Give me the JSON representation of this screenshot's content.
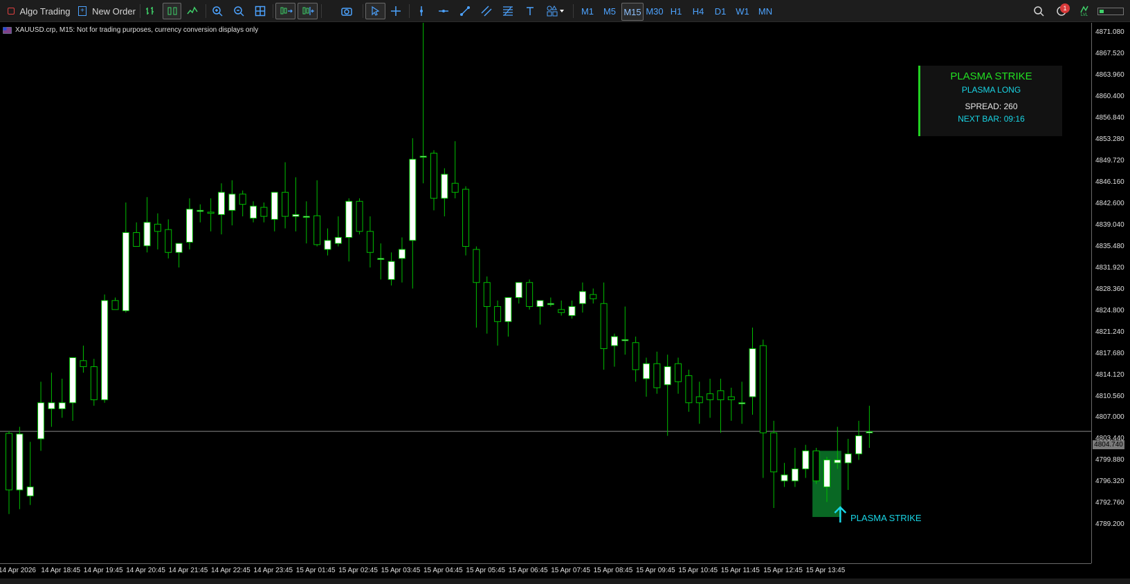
{
  "toolbar": {
    "algo_trading": "Algo Trading",
    "new_order": "New Order",
    "timeframes": [
      "M1",
      "M5",
      "M15",
      "M30",
      "H1",
      "H4",
      "D1",
      "W1",
      "MN"
    ],
    "selected_timeframe": "M15",
    "notification_count": "1",
    "lvl_label": "LVL"
  },
  "symbol_info": "XAUUSD.crp, M15:  Not for trading purposes, currency conversion displays only",
  "panel": {
    "title": "PLASMA STRIKE",
    "signal": "PLASMA LONG",
    "spread": "SPREAD: 260",
    "next_bar": "NEXT BAR: 09:16"
  },
  "signal_label": "PLASMA STRIKE",
  "current_price": "4804.740",
  "colors": {
    "bull_fill": "#ffffff",
    "bear_fill": "#000000",
    "candle_border": "#00c000",
    "wick": "#00c000",
    "signal_box": "#0a7a2a",
    "signal_arrow": "#19d6e6",
    "panel_accent": "#22d022"
  },
  "chart_data": {
    "type": "candlestick",
    "symbol": "XAUUSD.crp",
    "timeframe": "M15",
    "price_ticks": [
      "4871.080",
      "4867.520",
      "4863.960",
      "4860.400",
      "4856.840",
      "4853.280",
      "4849.720",
      "4846.160",
      "4842.600",
      "4839.040",
      "4835.480",
      "4831.920",
      "4828.360",
      "4824.800",
      "4821.240",
      "4817.680",
      "4814.120",
      "4810.560",
      "4807.000",
      "4803.440",
      "4799.880",
      "4796.320",
      "4792.760",
      "4789.200"
    ],
    "time_labels": [
      "14 Apr 2026",
      "14 Apr 18:45",
      "14 Apr 19:45",
      "14 Apr 20:45",
      "14 Apr 21:45",
      "14 Apr 22:45",
      "14 Apr 23:45",
      "15 Apr 01:45",
      "15 Apr 02:45",
      "15 Apr 03:45",
      "15 Apr 04:45",
      "15 Apr 05:45",
      "15 Apr 06:45",
      "15 Apr 07:45",
      "15 Apr 08:45",
      "15 Apr 09:45",
      "15 Apr 10:45",
      "15 Apr 11:45",
      "15 Apr 12:45",
      "15 Apr 13:45"
    ],
    "ylim": [
      4786.5,
      4874.0
    ],
    "candles": [
      [
        4804.4,
        4804.8,
        4791.0,
        4795.0
      ],
      [
        4795.0,
        4805.5,
        4791.8,
        4804.3
      ],
      [
        4794.0,
        4803.0,
        4792.5,
        4795.5
      ],
      [
        4803.5,
        4813.0,
        4801.5,
        4809.5
      ],
      [
        4808.5,
        4814.5,
        4805.5,
        4809.5
      ],
      [
        4808.5,
        4813.5,
        4807.0,
        4809.5
      ],
      [
        4809.5,
        4816.5,
        4806.5,
        4817.0
      ],
      [
        4816.5,
        4819.0,
        4814.5,
        4815.5
      ],
      [
        4815.5,
        4816.8,
        4809.0,
        4810.0
      ],
      [
        4810.0,
        4827.5,
        4809.5,
        4826.5
      ],
      [
        4826.5,
        4827.0,
        4825.0,
        4825.0
      ],
      [
        4824.8,
        4842.8,
        4824.5,
        4837.8
      ],
      [
        4837.8,
        4839.5,
        4835.5,
        4835.5
      ],
      [
        4835.6,
        4843.7,
        4834.5,
        4839.5
      ],
      [
        4839.2,
        4841.0,
        4835.0,
        4838.0
      ],
      [
        4838.3,
        4840.0,
        4833.5,
        4834.5
      ],
      [
        4834.5,
        4836.0,
        4832.0,
        4836.0
      ],
      [
        4836.2,
        4843.5,
        4835.0,
        4841.7
      ],
      [
        4841.5,
        4842.5,
        4839.5,
        4841.5
      ],
      [
        4841.2,
        4843.5,
        4838.0,
        4841.0
      ],
      [
        4840.8,
        4846.0,
        4837.5,
        4844.5
      ],
      [
        4841.5,
        4846.5,
        4839.0,
        4844.2
      ],
      [
        4844.2,
        4844.8,
        4840.5,
        4842.5
      ],
      [
        4840.2,
        4843.0,
        4839.5,
        4842.2
      ],
      [
        4842.0,
        4842.8,
        4839.5,
        4840.5
      ],
      [
        4840.0,
        4844.5,
        4838.0,
        4844.5
      ],
      [
        4844.5,
        4849.5,
        4838.5,
        4840.5
      ],
      [
        4840.5,
        4847.0,
        4838.0,
        4840.8
      ],
      [
        4840.5,
        4843.0,
        4836.0,
        4840.5
      ],
      [
        4840.6,
        4846.5,
        4835.5,
        4835.8
      ],
      [
        4835.0,
        4838.5,
        4834.0,
        4836.5
      ],
      [
        4836.0,
        4840.5,
        4835.5,
        4837.0
      ],
      [
        4837.0,
        4843.5,
        4833.0,
        4843.0
      ],
      [
        4843.0,
        4843.5,
        4837.5,
        4838.0
      ],
      [
        4838.0,
        4840.5,
        4832.0,
        4834.5
      ],
      [
        4833.5,
        4836.0,
        4830.0,
        4833.5
      ],
      [
        4830.0,
        4834.5,
        4829.0,
        4833.0
      ],
      [
        4833.5,
        4837.0,
        4829.5,
        4835.0
      ],
      [
        4836.5,
        4853.5,
        4828.5,
        4850.0
      ],
      [
        4850.5,
        4874.0,
        4846.0,
        4850.5
      ],
      [
        4851.0,
        4851.5,
        4841.5,
        4843.5
      ],
      [
        4843.5,
        4848.5,
        4840.5,
        4847.5
      ],
      [
        4846.0,
        4853.0,
        4843.5,
        4844.5
      ],
      [
        4845.0,
        4845.5,
        4834.0,
        4835.5
      ],
      [
        4835.0,
        4835.5,
        4822.0,
        4829.5
      ],
      [
        4829.5,
        4830.5,
        4821.0,
        4825.5
      ],
      [
        4825.5,
        4826.5,
        4819.0,
        4823.0
      ],
      [
        4823.0,
        4827.0,
        4820.5,
        4827.0
      ],
      [
        4827.0,
        4829.5,
        4826.0,
        4829.5
      ],
      [
        4829.5,
        4830.0,
        4825.0,
        4825.5
      ],
      [
        4825.5,
        4826.5,
        4822.5,
        4826.5
      ],
      [
        4826.0,
        4827.0,
        4825.5,
        4826.0
      ],
      [
        4825.0,
        4826.5,
        4824.0,
        4824.5
      ],
      [
        4824.0,
        4826.5,
        4823.5,
        4825.5
      ],
      [
        4826.0,
        4829.5,
        4824.5,
        4828.0
      ],
      [
        4827.5,
        4828.5,
        4826.0,
        4826.8
      ],
      [
        4826.0,
        4829.5,
        4815.0,
        4818.5
      ],
      [
        4819.0,
        4821.0,
        4815.5,
        4820.5
      ],
      [
        4820.0,
        4825.5,
        4817.5,
        4820.0
      ],
      [
        4819.5,
        4820.5,
        4813.0,
        4815.0
      ],
      [
        4813.5,
        4817.0,
        4810.5,
        4816.0
      ],
      [
        4816.0,
        4818.0,
        4811.0,
        4812.0
      ],
      [
        4812.5,
        4817.5,
        4804.0,
        4815.5
      ],
      [
        4816.0,
        4817.0,
        4811.0,
        4813.0
      ],
      [
        4814.0,
        4815.0,
        4808.0,
        4809.5
      ],
      [
        4810.5,
        4813.0,
        4806.0,
        4809.5
      ],
      [
        4811.0,
        4813.5,
        4807.0,
        4810.0
      ],
      [
        4811.5,
        4813.5,
        4804.5,
        4810.0
      ],
      [
        4810.5,
        4812.0,
        4806.5,
        4810.0
      ],
      [
        4809.5,
        4813.0,
        4806.0,
        4809.5
      ],
      [
        4810.5,
        4822.0,
        4807.5,
        4818.5
      ],
      [
        4819.0,
        4820.0,
        4797.0,
        4804.5
      ],
      [
        4804.5,
        4806.5,
        4792.0,
        4798.0
      ],
      [
        4796.5,
        4799.5,
        4795.5,
        4797.5
      ],
      [
        4796.5,
        4802.0,
        4795.5,
        4798.5
      ],
      [
        4798.5,
        4802.5,
        4797.0,
        4801.5
      ],
      [
        4801.5,
        4802.0,
        4796.0,
        4796.5
      ],
      [
        4795.5,
        4800.5,
        4793.0,
        4800.0
      ],
      [
        4799.5,
        4805.5,
        4798.5,
        4800.0
      ],
      [
        4799.5,
        4803.5,
        4795.0,
        4801.0
      ],
      [
        4801.0,
        4806.5,
        4800.0,
        4804.0
      ],
      [
        4804.5,
        4809.0,
        4802.0,
        4804.7
      ]
    ],
    "signal_box": {
      "start_index": 76,
      "end_index": 78,
      "high": 4801.5,
      "low": 4790.5
    },
    "signal_arrow_index": 78,
    "current_price_line": 4804.74
  }
}
